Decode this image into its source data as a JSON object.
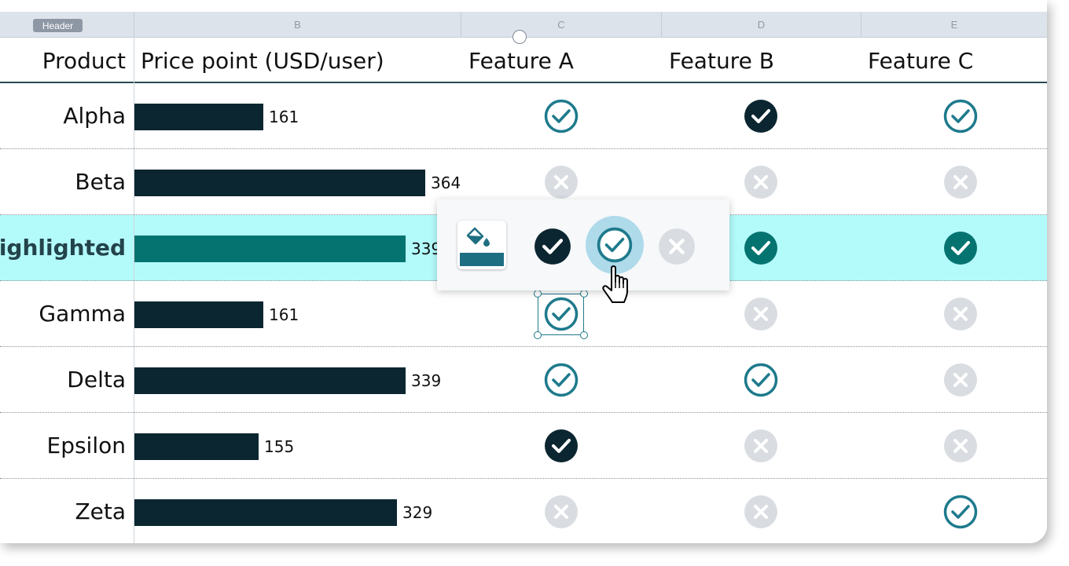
{
  "column_letters": [
    "B",
    "C",
    "D",
    "E"
  ],
  "header_badge": "Header",
  "headers": {
    "product": "Product",
    "price": "Price point (USD/user)",
    "feature_a": "Feature A",
    "feature_b": "Feature B",
    "feature_c": "Feature C"
  },
  "rows": [
    {
      "label": "Alpha",
      "price": 161,
      "price_label": "161",
      "features": [
        "check-outline",
        "check-solid-dark",
        "check-outline"
      ]
    },
    {
      "label": "Beta",
      "price": 364,
      "price_label": "364",
      "features": [
        "x-gray",
        "x-gray",
        "x-gray"
      ]
    },
    {
      "label": "Highlighted",
      "price": 339,
      "price_label": "339",
      "features": [
        "hidden",
        "check-solid-teal",
        "check-solid-teal"
      ],
      "highlighted": true
    },
    {
      "label": "Gamma",
      "price": 161,
      "price_label": "161",
      "features": [
        "check-outline",
        "x-gray",
        "x-gray"
      ]
    },
    {
      "label": "Delta",
      "price": 339,
      "price_label": "339",
      "features": [
        "check-outline",
        "check-outline",
        "x-gray"
      ]
    },
    {
      "label": "Epsilon",
      "price": 155,
      "price_label": "155",
      "features": [
        "check-solid-dark",
        "x-gray",
        "x-gray"
      ]
    },
    {
      "label": "Zeta",
      "price": 329,
      "price_label": "329",
      "features": [
        "x-gray",
        "x-gray",
        "check-outline"
      ]
    }
  ],
  "price_max": 364,
  "popup": {
    "options": [
      "paint-bucket-icon",
      "check-solid-dark-icon",
      "check-outline-icon",
      "x-gray-icon"
    ],
    "selected": "check-outline-icon"
  },
  "selected_cell": {
    "row": "Gamma",
    "column": "Feature A"
  },
  "colors": {
    "bar": "#0b2630",
    "bar_highlight": "#057470",
    "row_highlight": "#b3fbfb",
    "check_outline": "#1e7a8c",
    "check_solid_dark": "#0b2630",
    "check_solid_teal": "#057470",
    "x_gray": "#d9dde2"
  }
}
